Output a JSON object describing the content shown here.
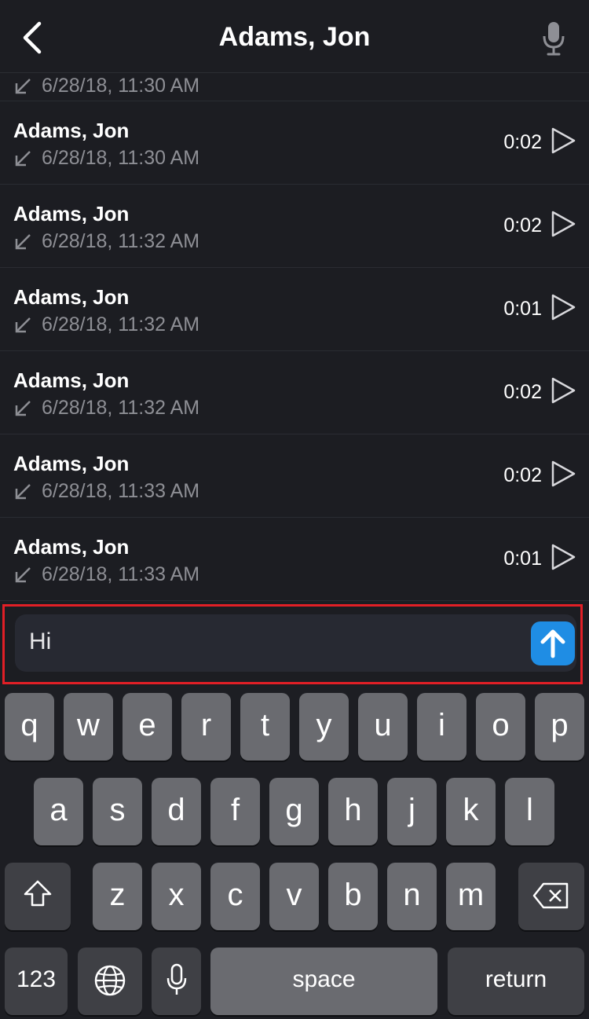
{
  "header": {
    "title": "Adams, Jon",
    "back_icon": "chevron-left-icon",
    "mic_icon": "microphone-icon"
  },
  "partial_row": {
    "time": "6/28/18, 11:30 AM"
  },
  "messages": [
    {
      "name": "Adams, Jon",
      "time": "6/28/18, 11:30 AM",
      "duration": "0:02"
    },
    {
      "name": "Adams, Jon",
      "time": "6/28/18, 11:32 AM",
      "duration": "0:02"
    },
    {
      "name": "Adams, Jon",
      "time": "6/28/18, 11:32 AM",
      "duration": "0:01"
    },
    {
      "name": "Adams, Jon",
      "time": "6/28/18, 11:32 AM",
      "duration": "0:02"
    },
    {
      "name": "Adams, Jon",
      "time": "6/28/18, 11:33 AM",
      "duration": "0:02"
    },
    {
      "name": "Adams, Jon",
      "time": "6/28/18, 11:33 AM",
      "duration": "0:01"
    }
  ],
  "compose": {
    "value": "Hi",
    "send_icon": "arrow-up-icon"
  },
  "keyboard": {
    "row1": [
      "q",
      "w",
      "e",
      "r",
      "t",
      "y",
      "u",
      "i",
      "o",
      "p"
    ],
    "row2": [
      "a",
      "s",
      "d",
      "f",
      "g",
      "h",
      "j",
      "k",
      "l"
    ],
    "row3": [
      "z",
      "x",
      "c",
      "v",
      "b",
      "n",
      "m"
    ],
    "numbers": "123",
    "space": "space",
    "return": "return"
  },
  "colors": {
    "background": "#1c1d22",
    "accent": "#1f8de4",
    "highlight": "#e11f26"
  }
}
